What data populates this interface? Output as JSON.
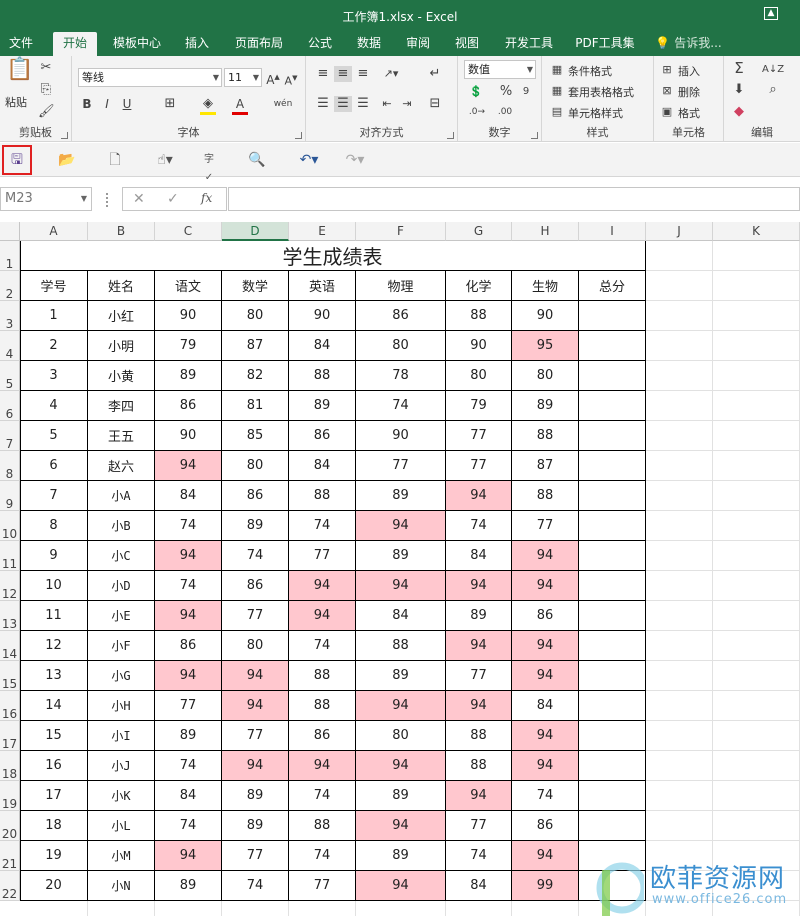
{
  "window": {
    "title": "工作簿1.xlsx - Excel"
  },
  "tabs": [
    "文件",
    "开始",
    "模板中心",
    "插入",
    "页面布局",
    "公式",
    "数据",
    "审阅",
    "视图",
    "开发工具",
    "PDF工具集",
    "告诉我..."
  ],
  "active_tab": "开始",
  "ribbon": {
    "clipboard": {
      "paste": "粘贴",
      "label": "剪贴板"
    },
    "font": {
      "name": "等线",
      "size": "11",
      "label": "字体",
      "phonetic": "wén"
    },
    "alignment": {
      "label": "对齐方式"
    },
    "number": {
      "format": "数值",
      "label": "数字"
    },
    "styles": {
      "conditional": "条件格式",
      "table": "套用表格格式",
      "cell": "单元格样式",
      "label": "样式"
    },
    "cells": {
      "insert": "插入",
      "delete": "删除",
      "format": "格式",
      "label": "单元格"
    },
    "editing": {
      "label": "编辑"
    }
  },
  "formula_bar": {
    "name_box": "M23",
    "fx": "fx",
    "value": ""
  },
  "columns": [
    "A",
    "B",
    "C",
    "D",
    "E",
    "F",
    "G",
    "H",
    "I",
    "J",
    "K"
  ],
  "selected_column": "D",
  "rows": [
    "1",
    "2",
    "3",
    "4",
    "5",
    "6",
    "7",
    "8",
    "9",
    "10",
    "11",
    "12",
    "13",
    "14",
    "15",
    "16",
    "17",
    "18",
    "19",
    "20",
    "21",
    "22"
  ],
  "sheet": {
    "title": "学生成绩表",
    "headers": [
      "学号",
      "姓名",
      "语文",
      "数学",
      "英语",
      "物理",
      "化学",
      "生物",
      "总分"
    ],
    "highlight_value": "94",
    "students": [
      [
        "1",
        "小红",
        "90",
        "80",
        "90",
        "86",
        "88",
        "90",
        ""
      ],
      [
        "2",
        "小明",
        "79",
        "87",
        "84",
        "80",
        "90",
        "95",
        ""
      ],
      [
        "3",
        "小黄",
        "89",
        "82",
        "88",
        "78",
        "80",
        "80",
        ""
      ],
      [
        "4",
        "李四",
        "86",
        "81",
        "89",
        "74",
        "79",
        "89",
        ""
      ],
      [
        "5",
        "王五",
        "90",
        "85",
        "86",
        "90",
        "77",
        "88",
        ""
      ],
      [
        "6",
        "赵六",
        "94",
        "80",
        "84",
        "77",
        "77",
        "87",
        ""
      ],
      [
        "7",
        "小A",
        "84",
        "86",
        "88",
        "89",
        "94",
        "88",
        ""
      ],
      [
        "8",
        "小B",
        "74",
        "89",
        "74",
        "94",
        "74",
        "77",
        ""
      ],
      [
        "9",
        "小C",
        "94",
        "74",
        "77",
        "89",
        "84",
        "94",
        ""
      ],
      [
        "10",
        "小D",
        "74",
        "86",
        "94",
        "94",
        "94",
        "94",
        ""
      ],
      [
        "11",
        "小E",
        "94",
        "77",
        "94",
        "84",
        "89",
        "86",
        ""
      ],
      [
        "12",
        "小F",
        "86",
        "80",
        "74",
        "88",
        "94",
        "94",
        ""
      ],
      [
        "13",
        "小G",
        "94",
        "94",
        "88",
        "89",
        "77",
        "94",
        ""
      ],
      [
        "14",
        "小H",
        "77",
        "94",
        "88",
        "94",
        "94",
        "84",
        ""
      ],
      [
        "15",
        "小I",
        "89",
        "77",
        "86",
        "80",
        "88",
        "94",
        ""
      ],
      [
        "16",
        "小J",
        "74",
        "94",
        "94",
        "94",
        "88",
        "94",
        ""
      ],
      [
        "17",
        "小K",
        "84",
        "89",
        "74",
        "89",
        "94",
        "74",
        ""
      ],
      [
        "18",
        "小L",
        "74",
        "89",
        "88",
        "94",
        "77",
        "86",
        ""
      ],
      [
        "19",
        "小M",
        "94",
        "77",
        "74",
        "89",
        "74",
        "94",
        ""
      ],
      [
        "20",
        "小N",
        "89",
        "74",
        "77",
        "94",
        "84",
        "99",
        ""
      ]
    ],
    "extra_highlights": [
      [
        1,
        7
      ],
      [
        19,
        7
      ]
    ]
  },
  "watermark": {
    "text": "欧菲资源网",
    "url": "www.office26.com"
  },
  "colors": {
    "excel_green": "#217346",
    "highlight_fill": "#ffc7ce",
    "save_box": "#e02020"
  }
}
